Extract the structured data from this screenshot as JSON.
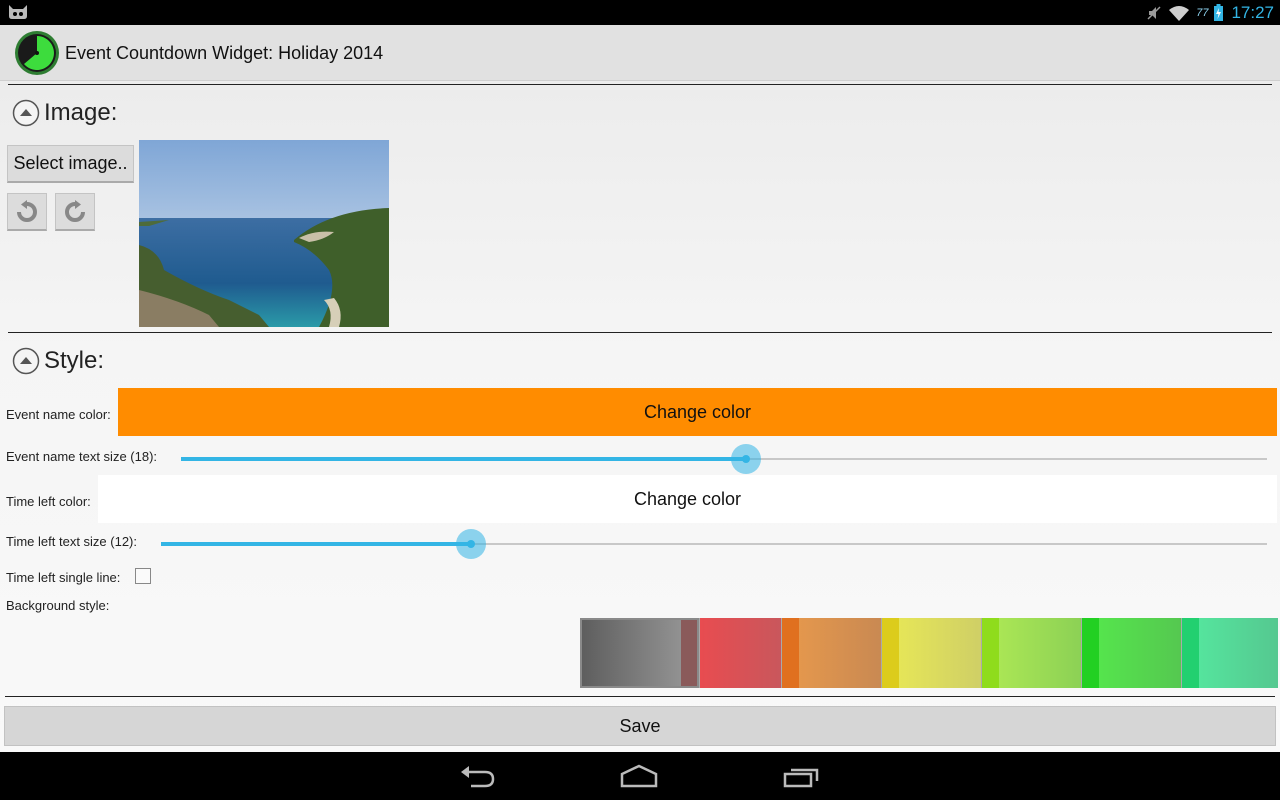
{
  "status_bar": {
    "battery_percent": "77",
    "time": "17:27"
  },
  "action_bar": {
    "title": "Event Countdown Widget: Holiday 2014"
  },
  "image_section": {
    "title": "Image:",
    "select_button": "Select image.."
  },
  "style_section": {
    "title": "Style:",
    "event_name_color_label": "Event name color:",
    "event_name_color_button": "Change color",
    "event_name_color": "#ff8c00",
    "event_name_size_label": "Event name text size (18):",
    "event_name_size_fraction": 0.52,
    "time_left_color_label": "Time left color:",
    "time_left_color_button": "Change color",
    "time_left_color": "#ffffff",
    "time_left_size_label": "Time left text size (12):",
    "time_left_size_fraction": 0.28,
    "single_line_label": "Time left single line:",
    "single_line_checked": false,
    "background_style_label": "Background style:",
    "background_swatches": [
      "gray",
      "red",
      "orange",
      "yellow",
      "lime",
      "green",
      "mint"
    ]
  },
  "save_button": "Save",
  "accent_color": "#33b5e5"
}
